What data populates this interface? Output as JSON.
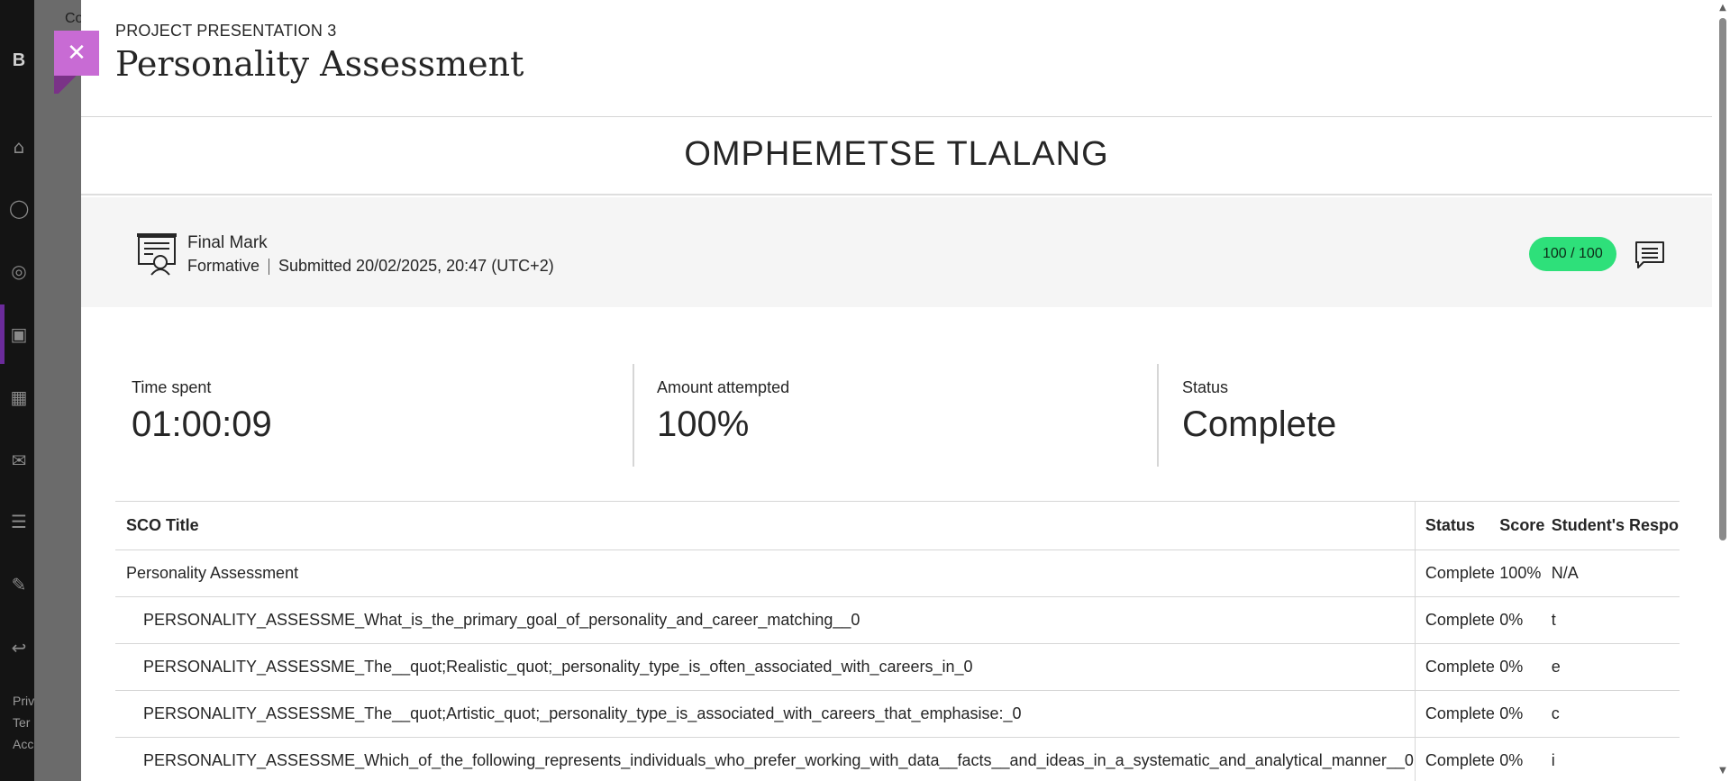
{
  "background": {
    "crumb_text": "Co",
    "logo_text": "B",
    "footer_lines": [
      "Priv",
      "Ter",
      "Acc"
    ]
  },
  "panel": {
    "overline": "PROJECT PRESENTATION 3",
    "title": "Personality Assessment",
    "student_name": "OMPHEMETSE TLALANG"
  },
  "grade": {
    "label": "Final Mark",
    "type": "Formative",
    "submitted": "Submitted 20/02/2025, 20:47 (UTC+2)",
    "score": "100 / 100",
    "score_color": "#2ee07a"
  },
  "stats": [
    {
      "label": "Time spent",
      "value": "01:00:09"
    },
    {
      "label": "Amount attempted",
      "value": "100%"
    },
    {
      "label": "Status",
      "value": "Complete"
    }
  ],
  "table": {
    "headers": [
      "SCO Title",
      "Status",
      "Score",
      "Student's Respo"
    ],
    "rows": [
      {
        "title": "Personality Assessment",
        "status": "Complete",
        "score": "100%",
        "response": "N/A"
      },
      {
        "title": "PERSONALITY_ASSESSME_What_is_the_primary_goal_of_personality_and_career_matching__0",
        "status": "Complete",
        "score": "0%",
        "response": "t"
      },
      {
        "title": "PERSONALITY_ASSESSME_The__quot;Realistic_quot;_personality_type_is_often_associated_with_careers_in_0",
        "status": "Complete",
        "score": "0%",
        "response": "e"
      },
      {
        "title": "PERSONALITY_ASSESSME_The__quot;Artistic_quot;_personality_type_is_associated_with_careers_that_emphasise:_0",
        "status": "Complete",
        "score": "0%",
        "response": "c"
      },
      {
        "title": "PERSONALITY_ASSESSME_Which_of_the_following_represents_individuals_who_prefer_working_with_data__facts__and_ideas_in_a_systematic_and_analytical_manner__0",
        "status": "Complete",
        "score": "0%",
        "response": "i"
      }
    ]
  },
  "icons": {
    "close": "close-icon",
    "grade": "certificate-icon",
    "feedback": "comment-icon"
  },
  "colors": {
    "close_tab": "#c86bd4",
    "accent": "#6b2b9b"
  }
}
